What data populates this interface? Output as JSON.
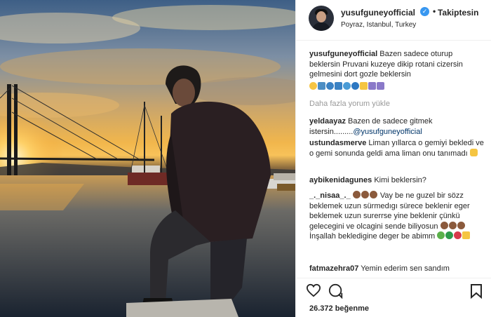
{
  "header": {
    "username": "yusufguneyofficial",
    "verified_icon": "verified-badge-icon",
    "separator": "•",
    "follow_label": "Takiptesin",
    "location": "Poyraz, Istanbul, Turkey"
  },
  "caption": {
    "username": "yusufguneyofficial",
    "text": "Bazen sadece oturup beklersin Pruvani kuzeye dikip rotani cizersin gelmesini dort gozle beklersin"
  },
  "load_more_label": "Daha fazla yorum yükle",
  "comments": [
    {
      "username": "yeldaayaz",
      "text": "Bazen de sadece gitmek istersin.........",
      "mention": "@yusufguneyofficial"
    },
    {
      "username": "ustundasmerve",
      "text": "Liman yıllarca o gemiyi bekledi ve o gemi sonunda geldi ama liman onu tanımadı"
    },
    {
      "username": "aybikenidagunes",
      "text": "Kimi beklersin?"
    },
    {
      "username": "_._nisaa_._",
      "text1": "Vay be ne guzel bir sözz beklemek uzun sürmedıgı sürece beklenir eger beklemek uzun surerrse yine beklenir çünkü gelecegini ve olcagini sende biliyosun",
      "text2": "İnşallah bekledigine deger be abimm"
    },
    {
      "username": "fatmazehra07",
      "text": "Yemin ederim sen sandım"
    }
  ],
  "actions": {
    "like_icon": "heart-icon",
    "comment_icon": "comment-icon",
    "save_icon": "bookmark-icon"
  },
  "likes": "26.372 beğenme",
  "colors": {
    "verified": "#3897f0",
    "link": "#003569",
    "muted": "#999999",
    "text": "#262626"
  }
}
